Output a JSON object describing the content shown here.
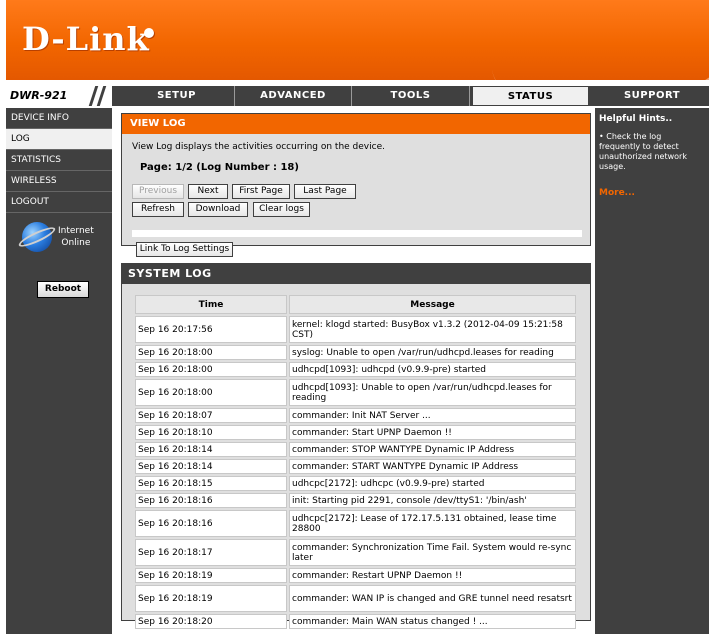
{
  "brand": {
    "logo_text": "D-Link",
    "model": "DWR-921"
  },
  "colors": {
    "accent": "#f26600",
    "dark": "#404040",
    "panel": "#dfdfdf"
  },
  "tabs": [
    {
      "label": "SETUP"
    },
    {
      "label": "ADVANCED"
    },
    {
      "label": "TOOLS"
    },
    {
      "label": "STATUS",
      "active": true
    },
    {
      "label": "SUPPORT"
    }
  ],
  "sidebar": {
    "items": [
      {
        "label": "DEVICE INFO"
      },
      {
        "label": "LOG",
        "active": true
      },
      {
        "label": "STATISTICS"
      },
      {
        "label": "WIRELESS"
      },
      {
        "label": "LOGOUT"
      }
    ],
    "internet_label": "Internet",
    "internet_status": "Online",
    "reboot_label": "Reboot"
  },
  "view_log": {
    "title": "VIEW LOG",
    "description": "View Log displays the activities occurring on the device.",
    "page_info": "Page: 1/2 (Log Number : 18)",
    "buttons": {
      "previous": "Previous",
      "next": "Next",
      "first_page": "First Page",
      "last_page": "Last Page",
      "refresh": "Refresh",
      "download": "Download",
      "clear_logs": "Clear logs",
      "link_settings": "Link To Log Settings"
    }
  },
  "system_log": {
    "title": "SYSTEM LOG",
    "columns": {
      "time": "Time",
      "message": "Message"
    },
    "rows": [
      {
        "time": "Sep 16 20:17:56",
        "message": "kernel: klogd started: BusyBox v1.3.2 (2012-04-09 15:21:58 CST)"
      },
      {
        "time": "Sep 16 20:18:00",
        "message": "syslog: Unable to open /var/run/udhcpd.leases for reading"
      },
      {
        "time": "Sep 16 20:18:00",
        "message": "udhcpd[1093]: udhcpd (v0.9.9-pre) started"
      },
      {
        "time": "Sep 16 20:18:00",
        "message": "udhcpd[1093]: Unable to open /var/run/udhcpd.leases for reading"
      },
      {
        "time": "Sep 16 20:18:07",
        "message": "commander: Init NAT Server ..."
      },
      {
        "time": "Sep 16 20:18:10",
        "message": "commander: Start UPNP Daemon !!"
      },
      {
        "time": "Sep 16 20:18:14",
        "message": "commander: STOP WANTYPE Dynamic IP Address"
      },
      {
        "time": "Sep 16 20:18:14",
        "message": "commander: START WANTYPE Dynamic IP Address"
      },
      {
        "time": "Sep 16 20:18:15",
        "message": "udhcpc[2172]: udhcpc (v0.9.9-pre) started"
      },
      {
        "time": "Sep 16 20:18:16",
        "message": "init: Starting pid 2291, console /dev/ttyS1: '/bin/ash'"
      },
      {
        "time": "Sep 16 20:18:16",
        "message": "udhcpc[2172]: Lease of 172.17.5.131 obtained, lease time 28800"
      },
      {
        "time": "Sep 16 20:18:17",
        "message": "commander: Synchronization Time Fail. System would re-sync later"
      },
      {
        "time": "Sep 16 20:18:19",
        "message": "commander: Restart UPNP Daemon !!"
      },
      {
        "time": "Sep 16 20:18:19",
        "message": "commander: WAN IP is changed and GRE tunnel need resatsrt"
      },
      {
        "time": "Sep 16 20:18:20",
        "message": "commander: Main WAN status changed ! ..."
      }
    ]
  },
  "hints": {
    "title": "Helpful Hints..",
    "text": "• Check the log frequently to detect unauthorized network usage.",
    "more": "More..."
  }
}
